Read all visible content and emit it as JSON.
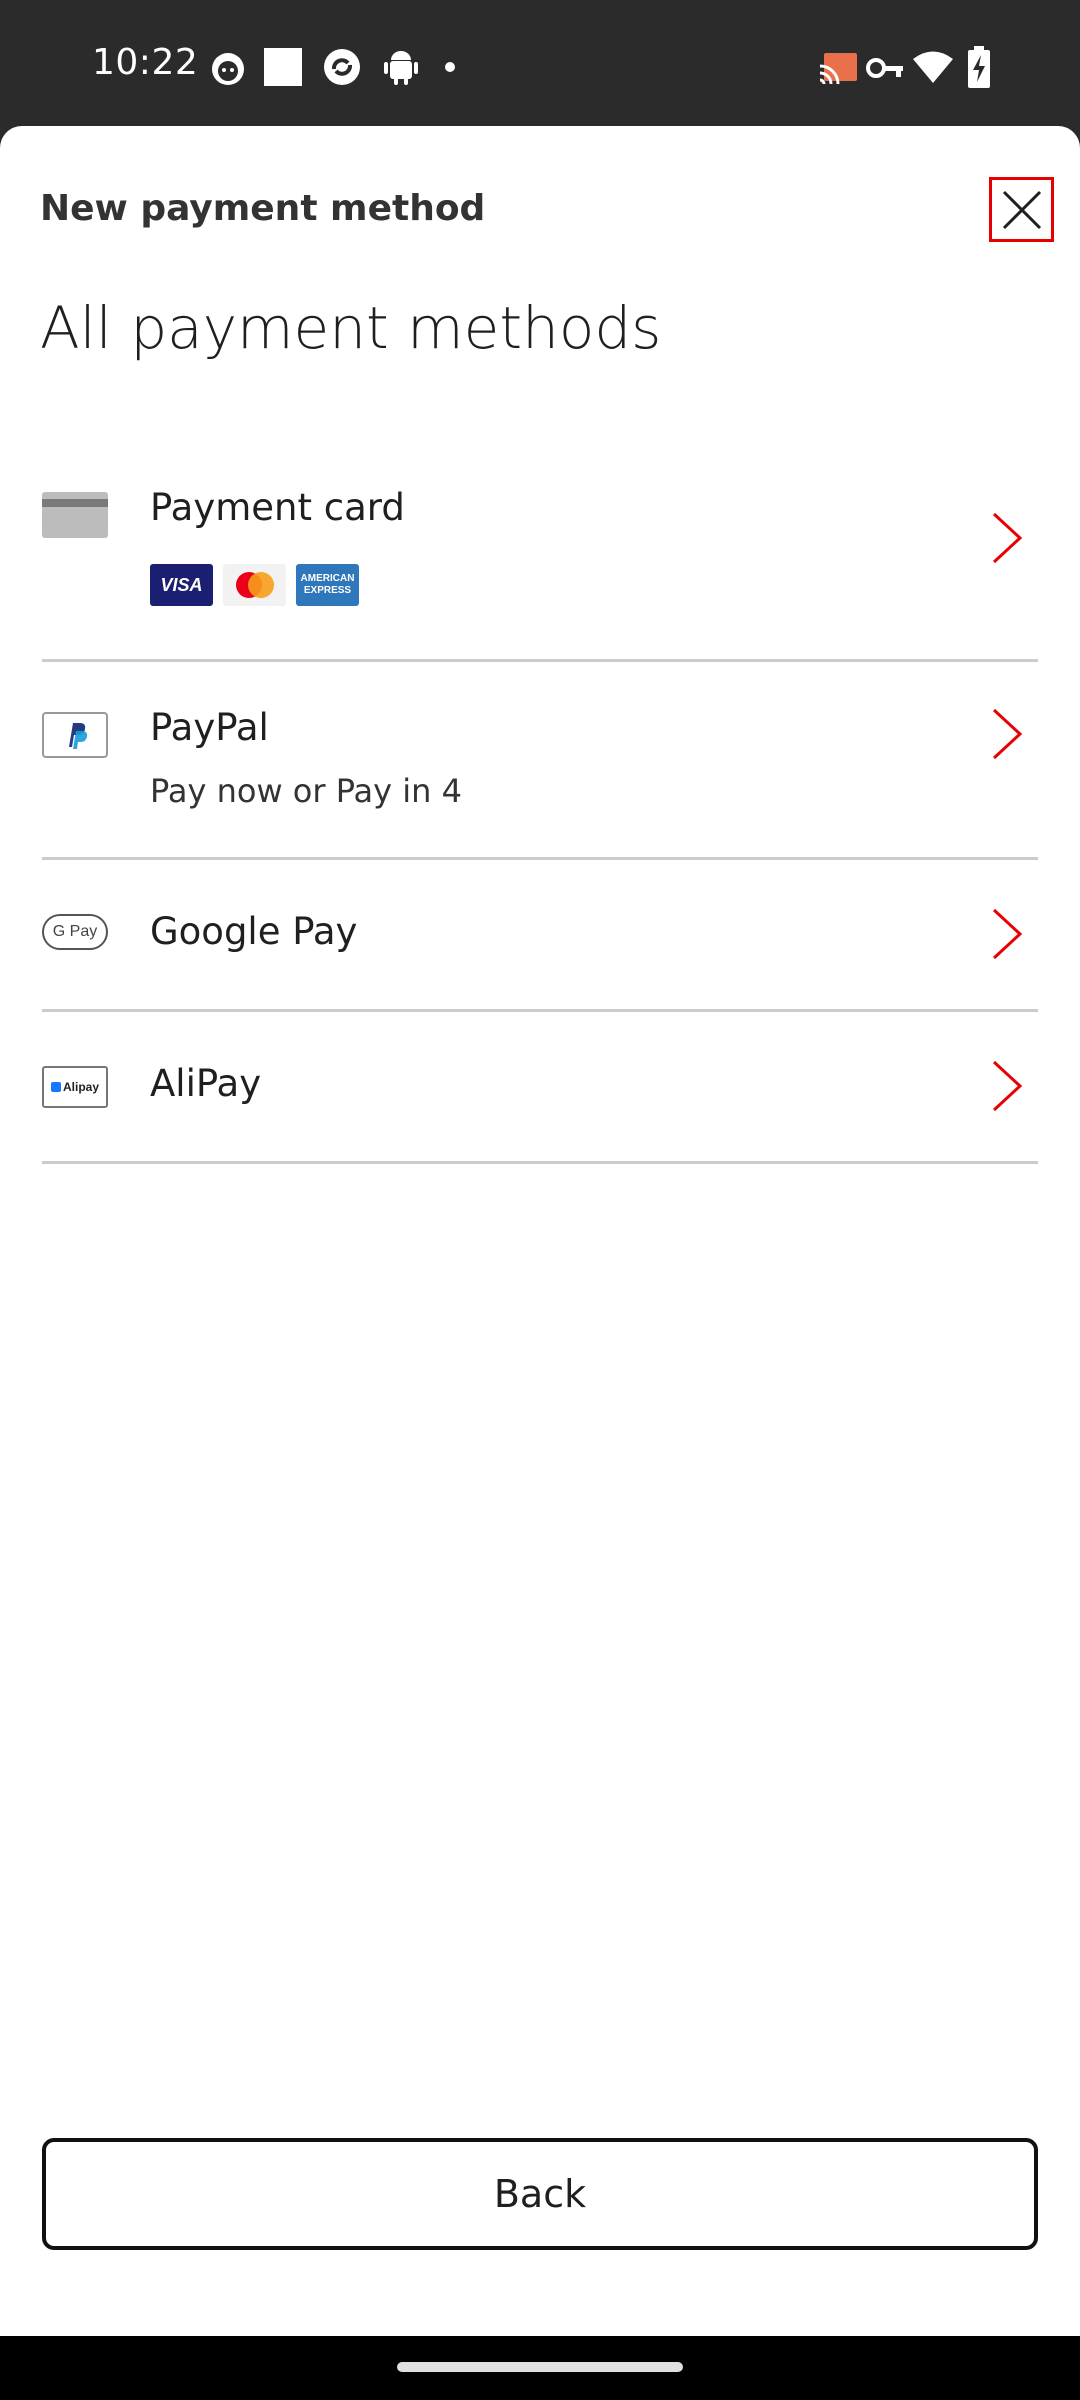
{
  "status_bar": {
    "time": "10:22",
    "left_icons": [
      "cat-face-icon",
      "white-square-icon",
      "sync-circle-icon",
      "android-icon",
      "dot-icon"
    ],
    "right_icons": [
      "cast-icon",
      "vpn-key-icon",
      "wifi-icon",
      "battery-charging-icon"
    ]
  },
  "sheet": {
    "title": "New payment method",
    "close_icon": "close-icon"
  },
  "heading": "All payment methods",
  "methods": [
    {
      "label": "Payment card",
      "icon": "credit-card-icon",
      "brands": [
        {
          "name": "VISA",
          "icon": "visa-logo-icon"
        },
        {
          "name": "mastercard",
          "icon": "mastercard-logo-icon"
        },
        {
          "name": "AMERICAN EXPRESS",
          "icon": "amex-logo-icon"
        }
      ]
    },
    {
      "label": "PayPal",
      "sub": "Pay now or Pay in 4",
      "icon": "paypal-icon"
    },
    {
      "label": "Google Pay",
      "icon": "google-pay-icon",
      "logo_text": "G Pay"
    },
    {
      "label": "AliPay",
      "icon": "alipay-icon",
      "logo_text": "Alipay"
    }
  ],
  "back_button": "Back",
  "colors": {
    "accent_red": "#e60000",
    "divider": "#cccccc",
    "status_bar_bg": "#2b2b2b"
  }
}
